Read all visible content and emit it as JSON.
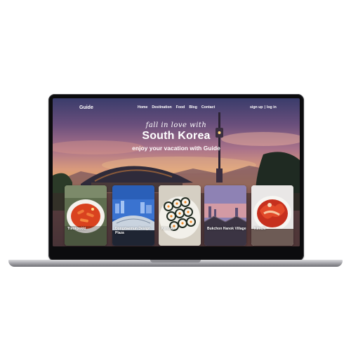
{
  "site": {
    "logo": "Guide",
    "nav": [
      "Home",
      "Destination",
      "Food",
      "Blog",
      "Contact"
    ],
    "auth": {
      "signup": "sign up",
      "divider": "|",
      "login": "log in"
    }
  },
  "hero": {
    "tagline": "fall in love with",
    "title": "South Korea",
    "subtitle": "enjoy your vacation with Guide"
  },
  "cards": [
    {
      "label": "Tteokpokki",
      "icon": "tteokbokki-photo"
    },
    {
      "label": "Dongdaemun Design Plaza",
      "icon": "ddp-photo"
    },
    {
      "label": "Kimbap",
      "icon": "kimbap-photo"
    },
    {
      "label": "Bukchon Hanok Village",
      "icon": "hanok-photo"
    },
    {
      "label": "Kimchi",
      "icon": "kimchi-photo"
    }
  ]
}
